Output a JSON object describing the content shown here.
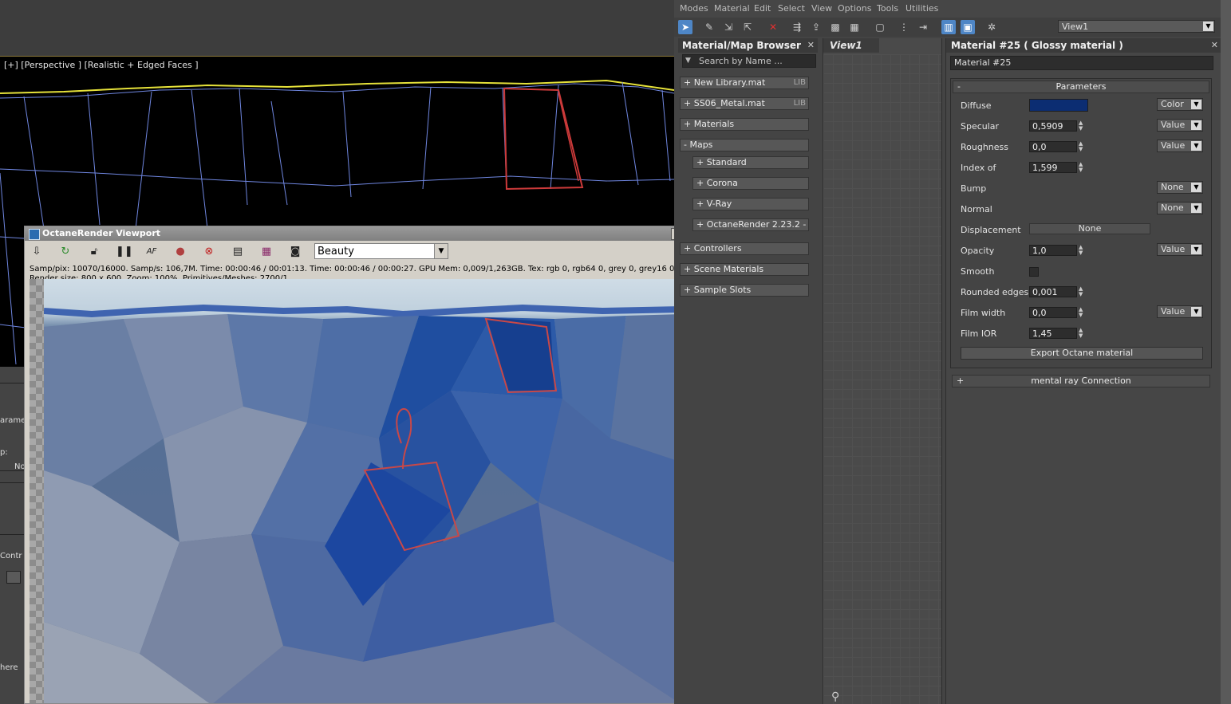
{
  "viewport": {
    "label": "[+] [Perspective ] [Realistic + Edged Faces ]"
  },
  "left_strip": {
    "texts": [
      "arame",
      "p:",
      "No",
      "Contr",
      "here"
    ]
  },
  "octane": {
    "title": "OctaneRender Viewport",
    "pass": "Beauty",
    "stats_line1": "Samp/pix: 10070/16000.   Samp/s: 106,7M.   Time: 00:00:46 / 00:01:13.   Time: 00:00:46 / 00:00:27.   GPU Mem: 0,009/1,263GB.   Tex: rgb 0, rgb64 0, grey 0, grey16 0.",
    "stats_line2": "Render size: 800 x 600.   Zoom: 100%.   Primitives/Meshes: 2700/1",
    "toolbar_icons": [
      "save-icon",
      "refresh-icon",
      "lock-icon",
      "pause-icon",
      "af-icon",
      "color-picker-icon",
      "clear-icon",
      "display-icon",
      "region-icon",
      "camera-icon"
    ]
  },
  "slate": {
    "menu": [
      "Modes",
      "Material",
      "Edit",
      "Select",
      "View",
      "Options",
      "Tools",
      "Utilities"
    ],
    "view_select": "View1",
    "browser": {
      "title": "Material/Map Browser",
      "search_placeholder": "Search by Name ...",
      "items": [
        {
          "label": "+ New Library.mat",
          "tag": "LIB"
        },
        {
          "label": "+ SS06_Metal.mat",
          "tag": "LIB"
        },
        {
          "label": "+ Materials",
          "tag": ""
        },
        {
          "label": "- Maps",
          "tag": ""
        },
        {
          "label": "+ Standard",
          "tag": ""
        },
        {
          "label": "+ Corona",
          "tag": ""
        },
        {
          "label": "+ V-Ray",
          "tag": ""
        },
        {
          "label": "+ OctaneRender 2.23.2 - ...",
          "tag": ""
        },
        {
          "label": "+ Controllers",
          "tag": ""
        },
        {
          "label": "+ Scene Materials",
          "tag": ""
        },
        {
          "label": "+ Sample Slots",
          "tag": ""
        }
      ]
    },
    "view_tab": "View1",
    "params": {
      "title": "Material #25  ( Glossy material )",
      "material_name": "Material #25",
      "rollout_title": "Parameters",
      "rollout_sign": "-",
      "diffuse_color": "#0c2d72",
      "rows": {
        "diffuse": {
          "label": "Diffuse",
          "mode": "Color"
        },
        "specular": {
          "label": "Specular",
          "value": "0,5909",
          "mode": "Value"
        },
        "roughness": {
          "label": "Roughness",
          "value": "0,0",
          "mode": "Value"
        },
        "index": {
          "label": "Index of",
          "value": "1,599"
        },
        "bump": {
          "label": "Bump",
          "mode": "None"
        },
        "normal": {
          "label": "Normal",
          "mode": "None"
        },
        "displacement": {
          "label": "Displacement",
          "button": "None"
        },
        "opacity": {
          "label": "Opacity",
          "value": "1,0",
          "mode": "Value"
        },
        "smooth": {
          "label": "Smooth"
        },
        "rounded": {
          "label": "Rounded edges",
          "value": "0,001"
        },
        "film_width": {
          "label": "Film width",
          "value": "0,0",
          "mode": "Value"
        },
        "film_ior": {
          "label": "Film IOR",
          "value": "1,45"
        }
      },
      "export_button": "Export Octane material",
      "mr_sign": "+",
      "mr_title": "mental ray Connection"
    }
  }
}
